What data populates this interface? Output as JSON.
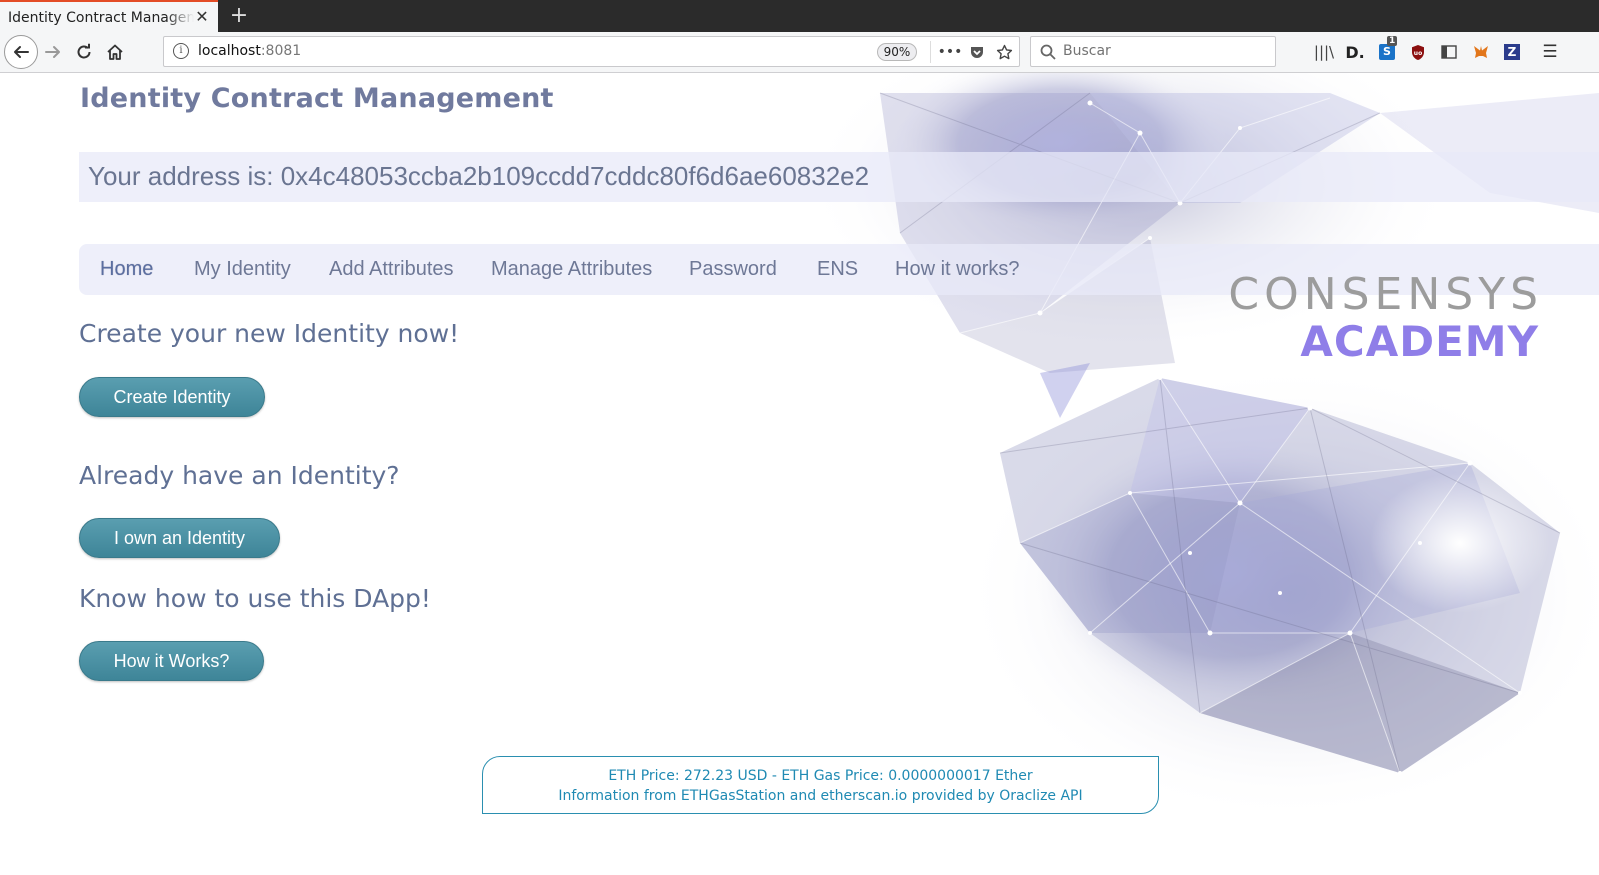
{
  "browser": {
    "tab_title": "Identity Contract Management",
    "url_host": "localhost",
    "url_port": ":8081",
    "zoom": "90%",
    "search_placeholder": "Buscar",
    "badge_count": "1"
  },
  "page": {
    "title": "Identity Contract Management",
    "address_label": "Your address is: 0x4c48053ccba2b109ccdd7cddc80f6d6ae60832e2",
    "menu": [
      {
        "label": "Home",
        "active": true
      },
      {
        "label": "My Identity"
      },
      {
        "label": "Add Attributes"
      },
      {
        "label": "Manage Attributes"
      },
      {
        "label": "Password"
      },
      {
        "label": "ENS"
      },
      {
        "label": "How it works?"
      }
    ],
    "sections": [
      {
        "heading": "Create your new Identity now!",
        "button": "Create Identity"
      },
      {
        "heading": "Already have an Identity?",
        "button": "I own an Identity"
      },
      {
        "heading": "Know how to use this DApp!",
        "button": "How it Works?"
      }
    ],
    "footer": {
      "line1": "ETH Price: 272.23 USD - ETH Gas Price: 0.0000000017 Ether",
      "line2": "Information from ETHGasStation and etherscan.io provided by Oraclize API"
    },
    "brand": {
      "top": "CONSENSYS",
      "bottom": "ACADEMY"
    }
  },
  "colors": {
    "accent_button": "#4a90a4",
    "brand_purple": "#8f7ee8",
    "price_text": "#1f8ab3"
  }
}
